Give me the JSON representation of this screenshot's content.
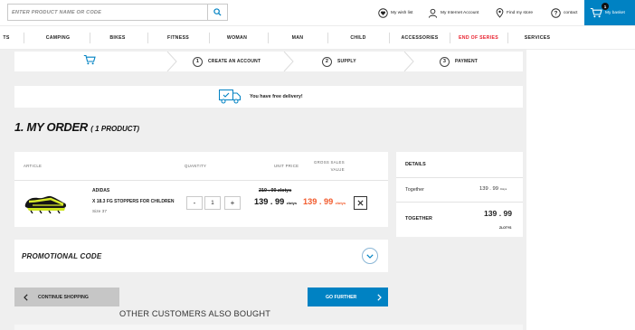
{
  "search": {
    "placeholder": "ENTER PRODUCT NAME OR CODE"
  },
  "header": {
    "wishlist": "My wish list",
    "account": "My Internet Account",
    "store": "Find my store",
    "contact": "contact",
    "basket": "My basket",
    "basket_count": "1"
  },
  "nav": {
    "items": [
      "TS",
      "CAMPING",
      "BIKES",
      "FITNESS",
      "WOMAN",
      "MAN",
      "CHILD",
      "ACCESSORIES",
      "END OF SERIES",
      "SERVICES"
    ],
    "highlight_color": "#e8212e"
  },
  "steps": [
    {
      "num": "1",
      "label": "CREATE AN ACCOUNT"
    },
    {
      "num": "2",
      "label": "SUPPLY"
    },
    {
      "num": "3",
      "label": "PAYMENT"
    }
  ],
  "delivery": {
    "text": "You have free delivery!"
  },
  "order": {
    "title": "1. MY ORDER",
    "subtitle": "( 1 PRODUCT)",
    "columns": {
      "article": "ARTICLE",
      "quantity": "QUANTITY",
      "unit_price": "UNIT PRICE",
      "gross_1": "GROSS SALES",
      "gross_2": "VALUE"
    },
    "product": {
      "brand": "ADIDAS",
      "name": "X 18.3 FG STOPPERS FOR CHILDREN",
      "size": "Size 37",
      "quantity": "1",
      "old_price": "219 . 99 zlotys",
      "unit_price": "139 . 99",
      "unit_currency": "zlotys",
      "gross_price": "139 . 99",
      "gross_currency": "zlotys"
    },
    "minus": "-",
    "plus": "+"
  },
  "details": {
    "title": "DETAILS",
    "together_label": "Together",
    "together_value": "139 . 99",
    "together_currency": "zlotys",
    "total_label": "TOGETHER",
    "total_value": "139 . 99",
    "total_currency": "ZLOTYS"
  },
  "promo": {
    "label": "PROMOTIONAL CODE"
  },
  "buttons": {
    "continue": "CONTINUE SHOPPING",
    "further": "GO FURTHER"
  },
  "also_bought": "OTHER CUSTOMERS ALSO BOUGHT",
  "colors": {
    "accent": "#0082c3",
    "sale": "#f25a2c",
    "bg": "#efefef"
  }
}
